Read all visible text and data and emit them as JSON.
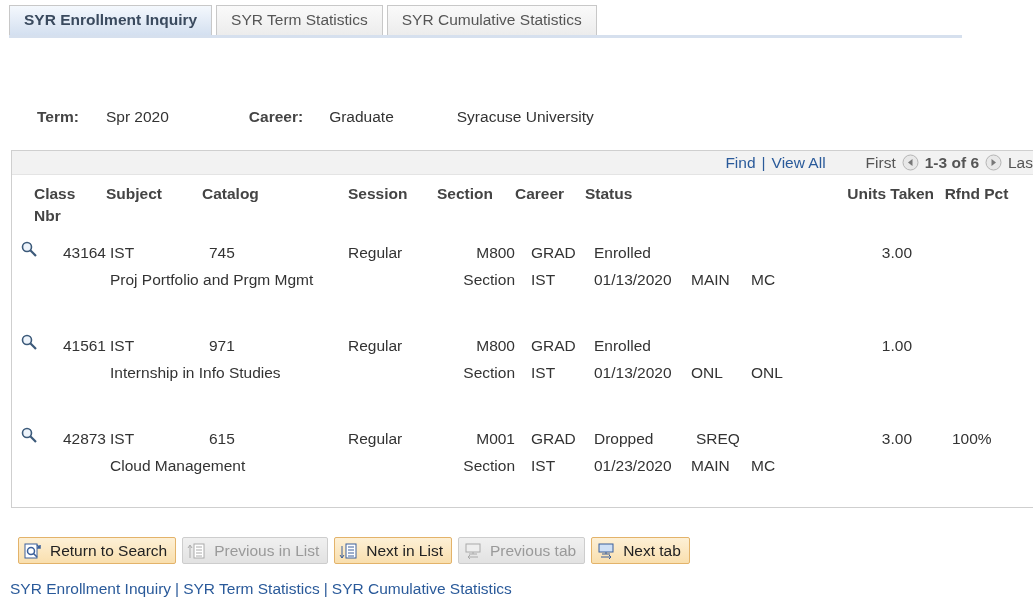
{
  "tabs": [
    {
      "label": "SYR Enrollment Inquiry",
      "selected": true
    },
    {
      "label": "SYR Term Statistics",
      "selected": false
    },
    {
      "label": "SYR Cumulative Statistics",
      "selected": false
    }
  ],
  "summary": {
    "term_label": "Term:",
    "term": "Spr 2020",
    "career_label": "Career:",
    "career": "Graduate",
    "institution": "Syracuse University"
  },
  "grid": {
    "find": "Find",
    "separator": "|",
    "view_all": "View All",
    "first": "First",
    "range": "1-3 of 6",
    "last": "Las",
    "columns": [
      "Class Nbr",
      "Subject",
      "Catalog",
      "Session",
      "Section",
      "Career",
      "Status",
      "Units Taken",
      "Rfnd Pct"
    ],
    "rows": [
      {
        "class_nbr": "43164",
        "subject": "IST",
        "catalog": "745",
        "session": "Regular",
        "section": "M800",
        "career": "GRAD",
        "status": "Enrolled",
        "units": "3.00",
        "description": "Proj Portfolio and Prgm Mgmt",
        "section_label": "Section",
        "component": "IST",
        "date": "01/13/2020",
        "location": "MAIN",
        "mode": "MC"
      },
      {
        "class_nbr": "41561",
        "subject": "IST",
        "catalog": "971",
        "session": "Regular",
        "section": "M800",
        "career": "GRAD",
        "status": "Enrolled",
        "units": "1.00",
        "description": "Internship in Info Studies",
        "section_label": "Section",
        "component": "IST",
        "date": "01/13/2020",
        "location": "ONL",
        "mode": "ONL"
      },
      {
        "class_nbr": "42873",
        "subject": "IST",
        "catalog": "615",
        "session": "Regular",
        "section": "M001",
        "career": "GRAD",
        "status": "Dropped",
        "status_reason": "SREQ",
        "units": "3.00",
        "refund_pct": "100%",
        "description": "Cloud Management",
        "section_label": "Section",
        "component": "IST",
        "date": "01/23/2020",
        "location": "MAIN",
        "mode": "MC"
      }
    ]
  },
  "buttons": [
    {
      "label": "Return to Search",
      "kind": "return",
      "disabled": false
    },
    {
      "label": "Previous in List",
      "kind": "prev-list",
      "disabled": true
    },
    {
      "label": "Next in List",
      "kind": "next-list",
      "disabled": false
    },
    {
      "label": "Previous tab",
      "kind": "prev-tab",
      "disabled": true
    },
    {
      "label": "Next tab",
      "kind": "next-tab",
      "disabled": false
    }
  ],
  "footer_links": [
    "SYR Enrollment Inquiry",
    "SYR Term Statistics",
    "SYR Cumulative Statistics"
  ],
  "footer_separators": [
    "|",
    "|"
  ]
}
